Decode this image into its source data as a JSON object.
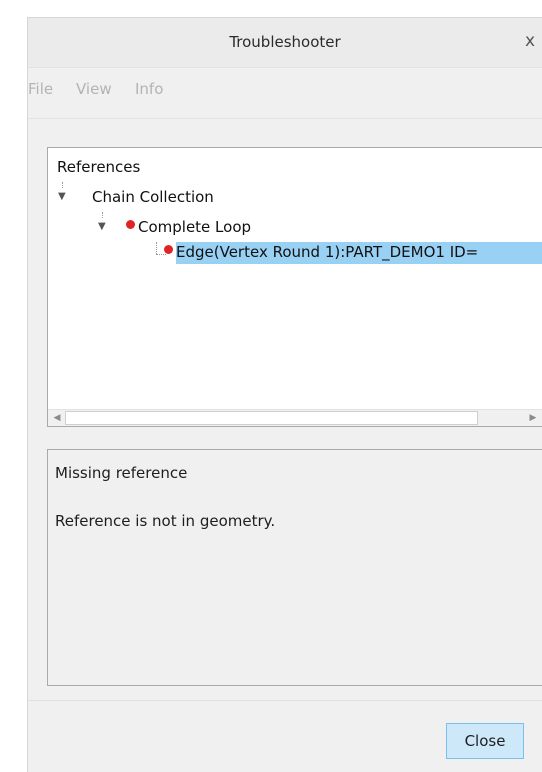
{
  "window": {
    "title": "Troubleshooter",
    "close_glyph": "x"
  },
  "menu": {
    "items": [
      "File",
      "View",
      "Info"
    ]
  },
  "tree": {
    "root_label": "References",
    "nodes": [
      {
        "label": "Chain Collection",
        "level": 1,
        "has_error_dot": false
      },
      {
        "label": "Complete Loop",
        "level": 2,
        "has_error_dot": true
      },
      {
        "label": "Edge(Vertex Round 1):PART_DEMO1 ID=",
        "level": 3,
        "has_error_dot": true,
        "selected": true
      }
    ]
  },
  "message": {
    "title": "Missing reference",
    "detail": "Reference is not in geometry."
  },
  "footer": {
    "close_label": "Close"
  },
  "colors": {
    "error_dot": "#e02424",
    "selection": "#99d1f5",
    "button_bg": "#cde8f8",
    "button_border": "#7cc0ea"
  },
  "icons": {
    "expand": "expand-arrow-icon",
    "error": "error-dot-icon",
    "close": "close-icon",
    "scroll_left": "scroll-left-icon",
    "scroll_right": "scroll-right-icon"
  }
}
